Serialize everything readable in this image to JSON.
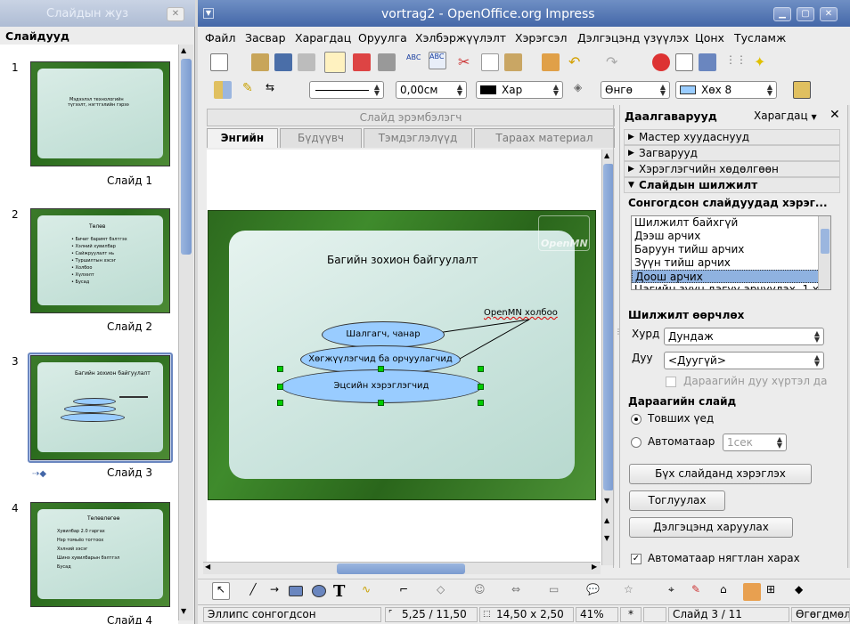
{
  "left_window": {
    "title": "Слайдын жуз",
    "pane_header": "Слайдууд",
    "slides": [
      {
        "number": "1",
        "label": "Слайд 1",
        "content": [
          "Мэдээлэл технологийн",
          "түгээлт, нэгтгэлийн гэрээ"
        ]
      },
      {
        "number": "2",
        "label": "Слайд 2",
        "content": [
          "Төлөв",
          "• Бичиг баримт бэлтгэх",
          "• Хэлний хувилбар",
          "• Сайжруулалт нь",
          "• Туршилтын хэсэг",
          "• Холбоо",
          "• Хүлээлт",
          "• Бусад"
        ]
      },
      {
        "number": "3",
        "label": "Слайд 3",
        "content": [
          "Багийн зохион байгуулалт"
        ]
      },
      {
        "number": "4",
        "label": "Слайд 4",
        "content": [
          "Төлөвлөгөө",
          "Хувилбар 2.0 гаргах",
          "Нэр томьёо тогтоох",
          "Хэлний хэсэг",
          "Шинэ хувилбарын бэлтгэл",
          "Бусад"
        ]
      }
    ]
  },
  "main_window": {
    "title": "vortrag2 - OpenOffice.org Impress",
    "menu": [
      "Файл",
      "Засвар",
      "Харагдац",
      "Оруулга",
      "Хэлбэржүүлэлт",
      "Хэрэгсэл",
      "Дэлгэцэнд үзүүлэх",
      "Цонх",
      "Тусламж"
    ],
    "line_width_value": "0,00см",
    "line_color_value": "Хар",
    "area_style_value": "Өнгө",
    "area_color_value": "Хөх 8",
    "view_tabs_header": "Слайд эрэмбэлэгч",
    "view_tabs": [
      "Энгийн",
      "Бүдүүвч",
      "Тэмдэглэлүүд",
      "Тараах материал"
    ],
    "slide": {
      "title": "Багийн зохион байгуулалт",
      "callout": "OpenMN холбоо",
      "logo_text": "OpenMN",
      "ellipses": [
        "Шалгагч, чанар батлагчид",
        "Хөгжүүлэгчид ба орчуулагчид",
        "Эцсийн хэрэглэгчид"
      ]
    }
  },
  "task_pane": {
    "header": "Даалгаварууд",
    "view_menu": "Харагдац",
    "sections": [
      "Мастер хуудаснууд",
      "Загварууд",
      "Хэрэглэгчийн хөдөлгөөн",
      "Слайдын шилжилт"
    ],
    "apply_label": "Сонгогдсон слайдуудад хэрэг...",
    "transitions": [
      "Шилжилт байхгүй",
      "Дээш арчих",
      "Баруун тийш арчих",
      "Зүүн тийш арчих",
      "Доош арчих",
      "Цагийн зүүн дагуу арчуулах, 1 хэ"
    ],
    "selected_transition": "Доош арчих",
    "modify_header": "Шилжилт өөрчлөх",
    "speed_label": "Хурд",
    "speed_value": "Дундаж",
    "sound_label": "Дуу",
    "sound_value": "<Дуугүй>",
    "loop_label": "Дараагийн дуу хүртэл да",
    "advance_header": "Дараагийн слайд",
    "on_click_label": "Товших үед",
    "auto_label": "Автоматаар",
    "auto_time": "1сек",
    "apply_all_button": "Бүх слайданд хэрэглэх",
    "play_button": "Тоглуулах",
    "slideshow_button": "Дэлгэцэнд харуулах",
    "auto_preview_label": "Автоматаар нягтлан харах"
  },
  "status_bar": {
    "selection": "Эллипс сонгогдсон",
    "position": "5,25 / 11,50",
    "size": "14,50 x 2,50",
    "zoom": "41%",
    "modified": "*",
    "slide": "Слайд 3 / 11",
    "layout": "Өгөгдмөл"
  },
  "colors": {
    "accent": "#4467a8",
    "selection": "#8fb2e0",
    "slide_bg": "#2d6a1e",
    "ellipse_fill": "#99ccff"
  }
}
